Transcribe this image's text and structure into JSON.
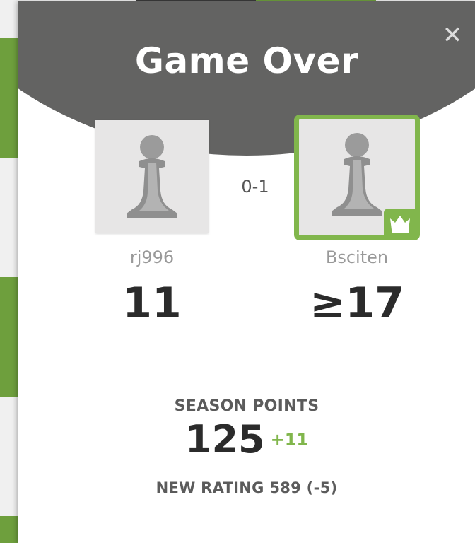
{
  "modal": {
    "title": "Game Over",
    "close_icon": "close-icon",
    "close_glyph": "✕",
    "result": "0-1"
  },
  "players": {
    "left": {
      "username": "rj996",
      "points": "11",
      "avatar_icon": "pawn-icon"
    },
    "right": {
      "username": "Bsciten",
      "points": "≥17",
      "avatar_icon": "pawn-icon",
      "winner_badge_icon": "crown-icon"
    }
  },
  "season": {
    "label": "SEASON POINTS",
    "value": "125",
    "delta": "+11"
  },
  "rating": {
    "text": "NEW RATING 589 (-5)"
  },
  "colors": {
    "header": "#636362",
    "accent_green": "#81b64c",
    "board_green": "#6e9f3d",
    "text_dark": "#2b2b2b",
    "text_muted": "#999999"
  }
}
